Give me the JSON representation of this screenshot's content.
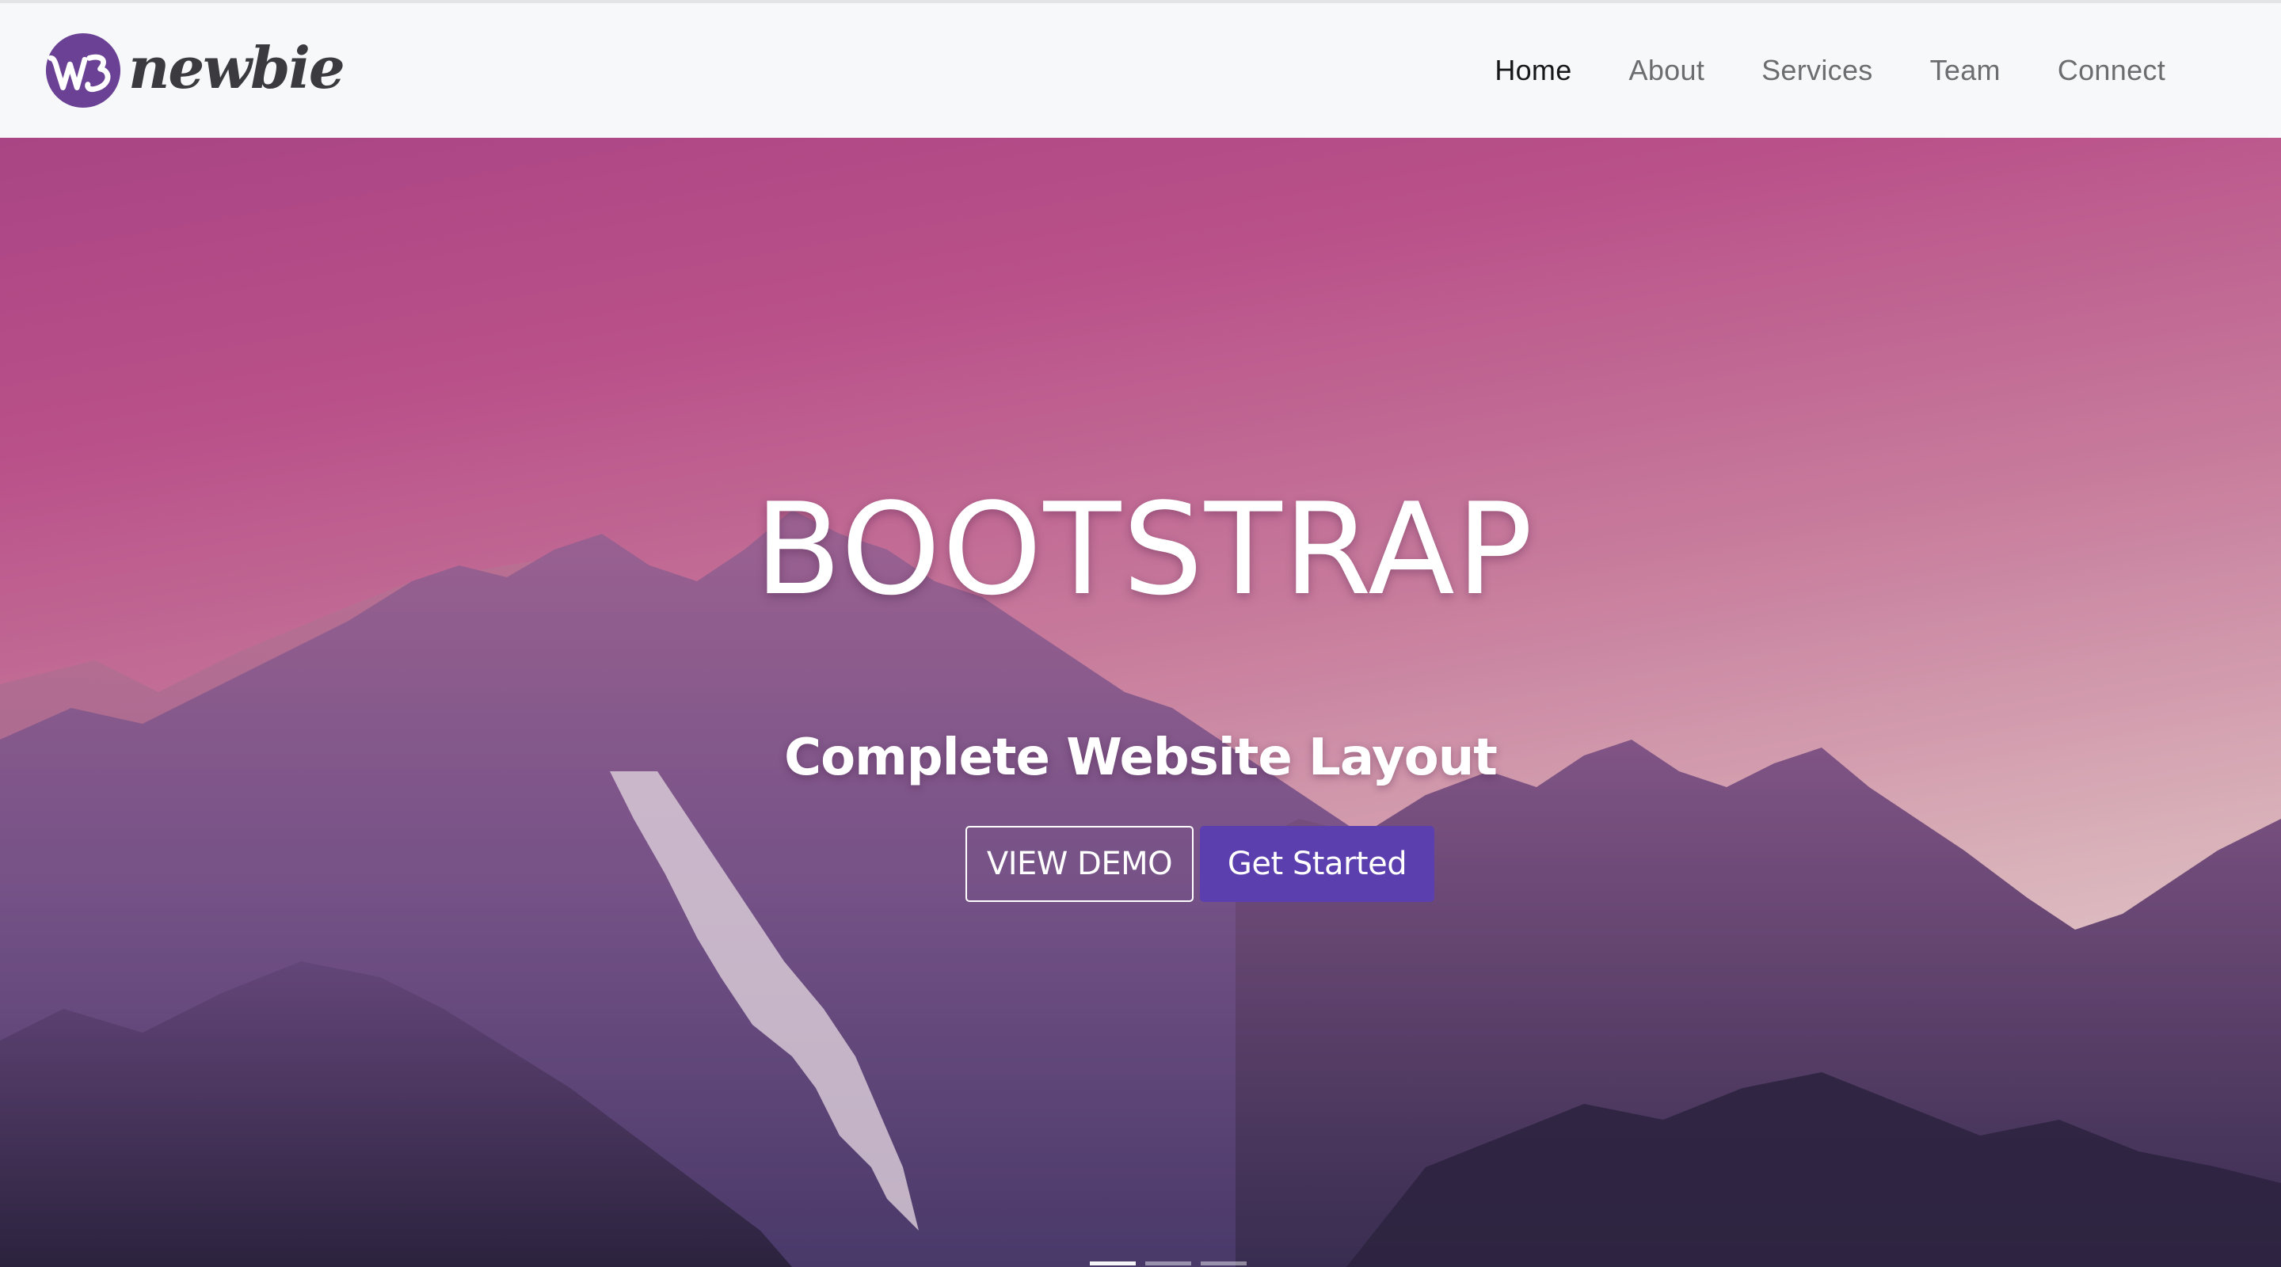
{
  "navbar": {
    "brand_text": "newbie",
    "brand_mark_icon": "w3-logo-icon",
    "links": [
      {
        "label": "Home",
        "active": true
      },
      {
        "label": "About",
        "active": false
      },
      {
        "label": "Services",
        "active": false
      },
      {
        "label": "Team",
        "active": false
      },
      {
        "label": "Connect",
        "active": false
      }
    ]
  },
  "hero": {
    "title": "BOOTSTRAP",
    "subtitle": "Complete Website Layout",
    "buttons": {
      "view_demo": "VIEW DEMO",
      "get_started": "Get Started"
    },
    "indicators": [
      {
        "active": true
      },
      {
        "active": false
      },
      {
        "active": false
      }
    ]
  },
  "colors": {
    "primary": "#5c3fae",
    "navbar_bg": "#f7f8f9",
    "nav_text": "#6b6d71",
    "nav_active": "#17181a",
    "sky_top": "#c44f8f",
    "sky_bottom": "#e9c2c8",
    "mountain": "#6e4a86"
  }
}
